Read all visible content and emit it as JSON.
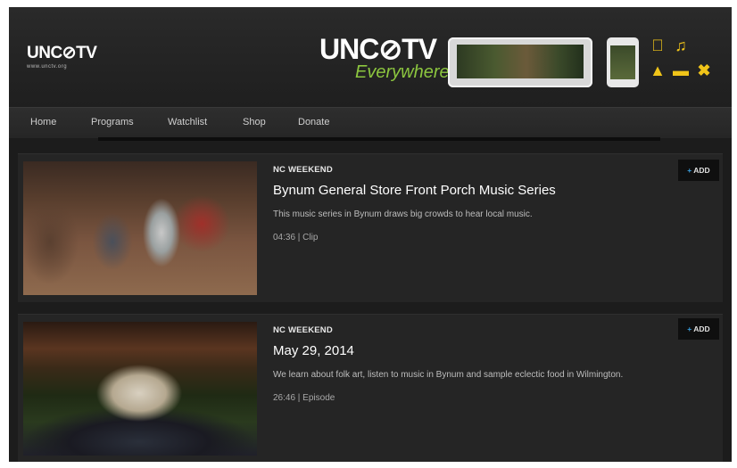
{
  "header": {
    "logo_text": "UNC⊘TV",
    "logo_url": "www.unctv.org",
    "banner_brand": "UNC⊘TV",
    "banner_tagline": "Everywhere...",
    "platform_icons": [
      "apple-icon",
      "itunes-icon",
      "graduation-cap-icon",
      "tablet-icon",
      "xbox-icon"
    ]
  },
  "nav": {
    "items": [
      "Home",
      "Programs",
      "Watchlist",
      "Shop",
      "Donate"
    ]
  },
  "cards": [
    {
      "show": "NC WEEKEND",
      "title": "Bynum General Store Front Porch Music Series",
      "description": "This music series in Bynum draws big crowds to hear local music.",
      "meta": "04:36 | Clip",
      "add_label": "ADD",
      "add_symbol": "+"
    },
    {
      "show": "NC WEEKEND",
      "title": "May 29, 2014",
      "description": "We learn about folk art, listen to music in Bynum and sample eclectic food in Wilmington.",
      "meta": "26:46 | Episode",
      "add_label": "ADD",
      "add_symbol": "+"
    }
  ],
  "colors": {
    "accent_green": "#8cc63f",
    "accent_blue": "#3aa0e0",
    "icon_yellow": "#f0c419",
    "background": "#1c1c1c"
  }
}
